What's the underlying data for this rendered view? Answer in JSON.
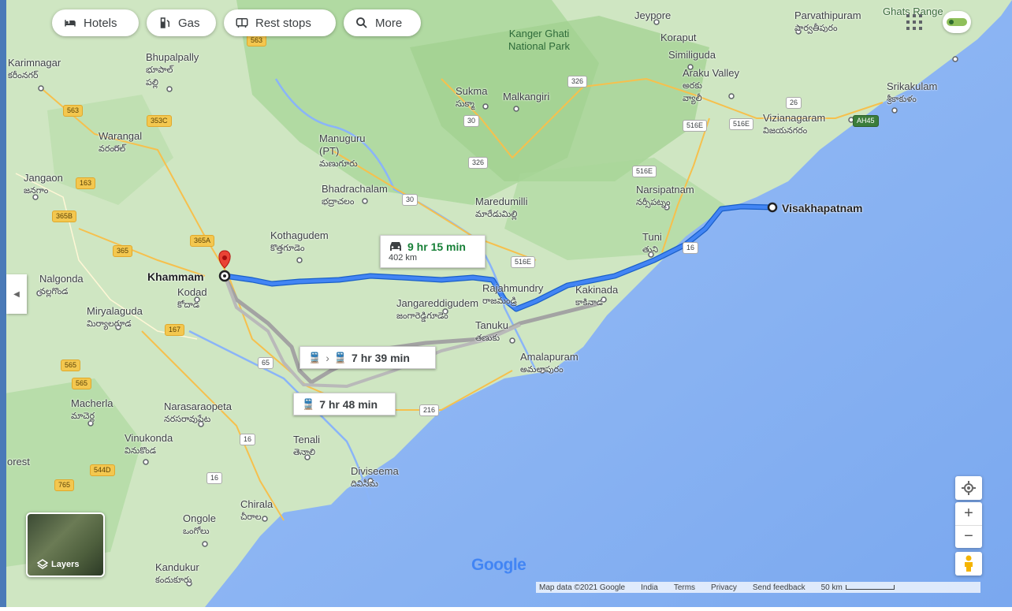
{
  "toolbar": {
    "hotels": "Hotels",
    "gas": "Gas",
    "rest_stops": "Rest stops",
    "more": "More"
  },
  "places": {
    "khammam": "Khammam",
    "visakhapatnam": "Visakhapatnam",
    "karimnagar": "Karimnagar",
    "karimnagar_te": "కరీంనగర్",
    "warangal": "Warangal",
    "warangal_te": "వరంగల్",
    "jangaon": "Jangaon",
    "jangaon_te": "జనగాం",
    "bhupalpally": "Bhupalpally",
    "bhupalpally_te": "భూపాల్\nపల్లి",
    "nalgonda": "Nalgonda",
    "nalgonda_te": "నల్లగొండ",
    "miryalaguda": "Miryalaguda",
    "miryalaguda_te": "మిర్యాలగూడ",
    "kodad": "Kodad",
    "kodad_te": "కోదాడ",
    "kothagudem": "Kothagudem",
    "kothagudem_te": "కొత్తగూడెం",
    "bhadrachalam": "Bhadrachalam",
    "bhadrachalam_te": "భద్రాచలం",
    "manuguru": "Manuguru\n(PT)",
    "manuguru_te": "మణుగూరు",
    "sukma": "Sukma",
    "sukma_te": "సుక్మా",
    "malkangiri": "Malkangiri",
    "jeypore": "Jeypore",
    "koraput": "Koraput",
    "simliguda": "Similiguda",
    "araku": "Araku Valley",
    "araku_te": "అరకు\nవ్యాలీ",
    "parvathipuram": "Parvathipuram",
    "parvathipuram_te": "పార్వతీపురం",
    "srikakulam": "Srikakulam",
    "srikakulam_te": "శ్రీకాకుళం",
    "vizianagaram": "Vizianagaram",
    "vizianagaram_te": "విజయనగరం",
    "narsipatnam": "Narsipatnam",
    "narsipatnam_te": "నర్సీపట్నం",
    "tuni": "Tuni",
    "tuni_te": "తుని",
    "maredumilli": "Maredumilli",
    "maredumilli_te": "మారేడుమిల్లి",
    "rajahmundry": "Rajahmundry",
    "rajahmundry_te": "రాజమండ్రి",
    "kakinada": "Kakinada",
    "kakinada_te": "కాకినాడ",
    "jangareddigudem": "Jangareddigudem",
    "jangareddigudem_te": "జంగారెడ్డిగూడెం",
    "tanuku": "Tanuku",
    "tanuku_te": "తణుకు",
    "amalapuram": "Amalapuram",
    "amalapuram_te": "అమలాపురం",
    "macherla": "Macherla",
    "macherla_te": "మాచెర్ల",
    "narasaraopeta": "Narasaraopeta",
    "narasaraopeta_te": "నరసరావుపేట",
    "vinukonda": "Vinukonda",
    "vinukonda_te": "వినుకొండ",
    "tenali": "Tenali",
    "tenali_te": "తెనాలి",
    "diviseema": "Diviseema",
    "diviseema_te": "దివిసీమ",
    "chirala": "Chirala",
    "chirala_te": "చీరాల",
    "ongole": "Ongole",
    "ongole_te": "ఒంగోలు",
    "kandukur": "Kandukur",
    "kandukur_te": "కందుకూరు",
    "kanger_park": "Kanger Ghati\nNational Park",
    "ghats": "Ghats Range",
    "edge_forest": "orest"
  },
  "shields": [
    "563",
    "353C",
    "163",
    "365B",
    "365A",
    "365",
    "167",
    "565",
    "565",
    "544D",
    "765",
    "65",
    "216",
    "16",
    "16",
    "16",
    "30",
    "30",
    "326",
    "326",
    "26",
    "516E",
    "516E",
    "516E",
    "516E",
    "AH45",
    "563"
  ],
  "routes": {
    "drive_time": "9 hr 15 min",
    "drive_distance": "402 km",
    "transit1_time": "7 hr 39 min",
    "transit2_time": "7 hr 48 min"
  },
  "controls": {
    "layers_label": "Layers",
    "zoom_in": "+",
    "zoom_out": "−"
  },
  "attribution": {
    "map_data": "Map data ©2021 Google",
    "india": "India",
    "terms": "Terms",
    "privacy": "Privacy",
    "feedback": "Send feedback",
    "scale": "50 km"
  },
  "logo": "Google",
  "colors": {
    "land": "#cde8c0",
    "forest": "#a9d79a",
    "sea": "#8ab4f8",
    "route_primary": "#4285f4",
    "route_alt": "#a3a3a3",
    "drive_time_color": "#188038",
    "pin": "#ea4335"
  }
}
